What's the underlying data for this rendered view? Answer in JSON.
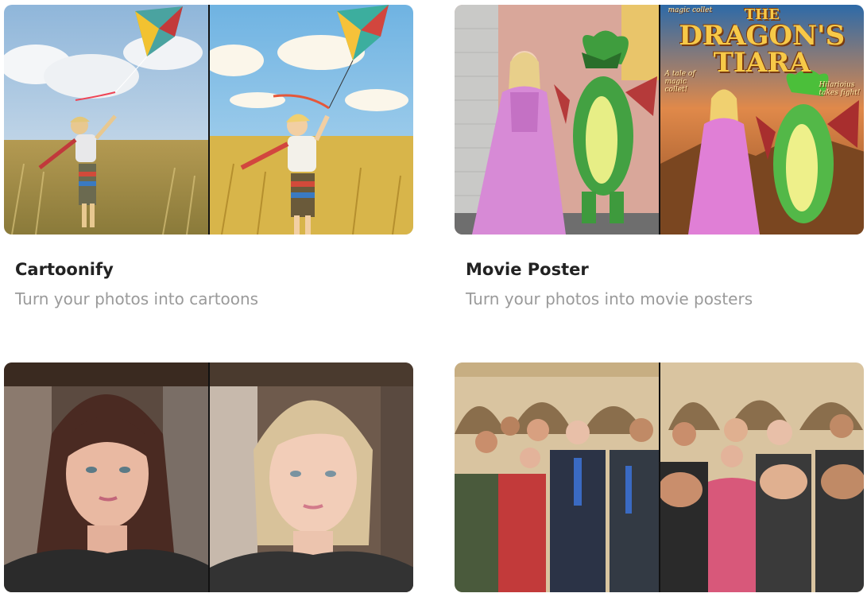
{
  "cards": [
    {
      "title": "Cartoonify",
      "subtitle": "Turn your photos into cartoons"
    },
    {
      "title": "Movie Poster",
      "subtitle": "Turn your photos into movie posters"
    },
    {
      "title": "",
      "subtitle": ""
    },
    {
      "title": "",
      "subtitle": ""
    }
  ],
  "poster": {
    "tagline_top": "magic collet",
    "title_line1": "THE",
    "title_line2": "DRAGON'S",
    "title_line3": "TIARA",
    "tag_left": "A tale of magic collet!",
    "tag_right": "Hilarioius takes fight!"
  },
  "colors": {
    "title": "#222222",
    "subtitle": "#9a9a9a",
    "divider": "#111111"
  }
}
